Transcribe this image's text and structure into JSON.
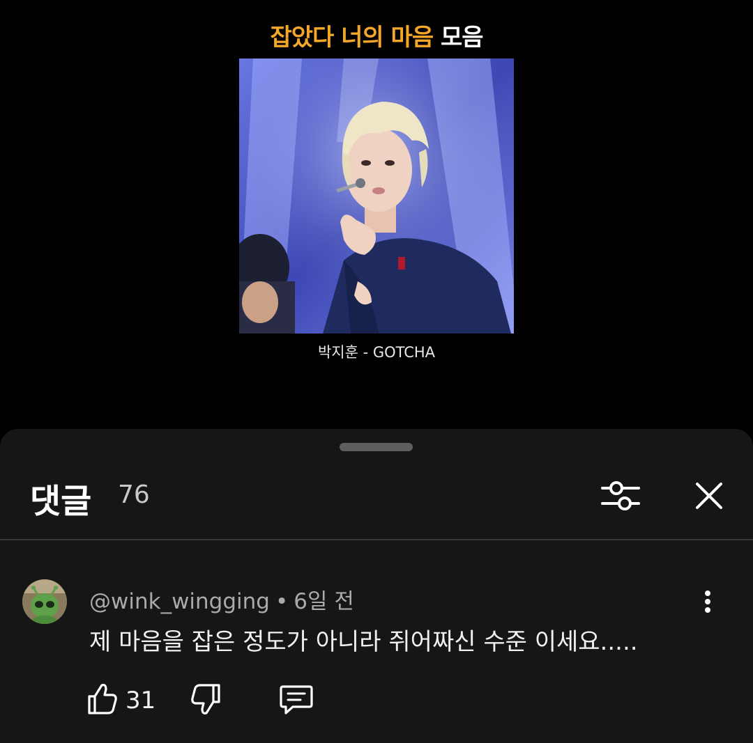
{
  "video": {
    "title_accent": "잡았다 너의 마음",
    "title_rest": "모음",
    "caption": "박지훈 - GOTCHA"
  },
  "comments_panel": {
    "title": "댓글",
    "count": "76",
    "filter_icon": "sliders-icon",
    "close_icon": "close-icon"
  },
  "comments": [
    {
      "author": "@wink_wingging",
      "separator": "•",
      "time": "6일 전",
      "text": "제 마음을 잡은 정도가 아니라 쥐어짜신 수준 이세요.....",
      "likes": "31",
      "icons": {
        "like": "thumbs-up-icon",
        "dislike": "thumbs-down-icon",
        "reply": "reply-icon",
        "more": "more-vertical-icon"
      }
    }
  ],
  "colors": {
    "accent": "#f5a72a",
    "sheet_bg": "#161616",
    "muted_text": "#aaaaaa"
  }
}
